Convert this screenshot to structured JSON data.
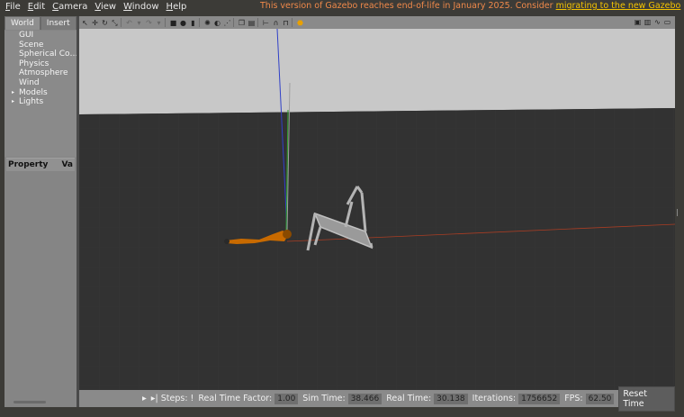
{
  "menu": [
    {
      "label": "File",
      "key": "F",
      "rest": "ile"
    },
    {
      "label": "Edit",
      "key": "E",
      "rest": "dit"
    },
    {
      "label": "Camera",
      "key": "C",
      "rest": "amera"
    },
    {
      "label": "View",
      "key": "V",
      "rest": "iew"
    },
    {
      "label": "Window",
      "key": "W",
      "rest": "indow"
    },
    {
      "label": "Help",
      "key": "H",
      "rest": "elp"
    }
  ],
  "banner": {
    "text": "This version of Gazebo reaches end-of-life in January 2025. Consider ",
    "link": "migrating to the new Gazebo",
    "text_color": "#f0894a",
    "link_color": "#f5c400"
  },
  "left_panel": {
    "tabs": [
      "World",
      "Insert"
    ],
    "tree": [
      {
        "label": "GUI",
        "expandable": false
      },
      {
        "label": "Scene",
        "expandable": false
      },
      {
        "label": "Spherical Co…",
        "expandable": false
      },
      {
        "label": "Physics",
        "expandable": false
      },
      {
        "label": "Atmosphere",
        "expandable": false
      },
      {
        "label": "Wind",
        "expandable": false
      },
      {
        "label": "Models",
        "expandable": true
      },
      {
        "label": "Lights",
        "expandable": true
      }
    ],
    "property_header": {
      "col1": "Property",
      "col2": "Va"
    }
  },
  "toolbar": {
    "icons": [
      "select-arrow-icon",
      "translate-icon",
      "rotate-icon",
      "scale-icon",
      "undo-icon",
      "undo-history-icon",
      "redo-icon",
      "redo-history-icon",
      "box-icon",
      "sphere-icon",
      "cylinder-icon",
      "point-light-icon",
      "spot-light-icon",
      "directional-light-icon",
      "copy-icon",
      "paste-icon",
      "align-icon",
      "snap-icon",
      "change-view-icon",
      "screenshot-icon"
    ],
    "right_icons": [
      "screenshot-icon",
      "log-icon",
      "plot-icon",
      "video-record-icon"
    ]
  },
  "bottom": {
    "steps_label": "Steps:",
    "steps_value": "!",
    "rtf_label": "Real Time Factor:",
    "rtf_value": "1.00",
    "sim_time_label": "Sim Time:",
    "sim_time_value": "38.466",
    "real_time_label": "Real Time:",
    "real_time_value": "30.138",
    "iterations_label": "Iterations:",
    "iterations_value": "1756652",
    "fps_label": "FPS:",
    "fps_value": "62.50",
    "reset_label": "Reset Time"
  },
  "colors": {
    "sky": "#c8c8c8",
    "ground": "#323232",
    "robot_arm": "#c86a00",
    "chair": "#b4b4b4",
    "axis_x": "#c84020",
    "axis_y": "#30a030",
    "axis_z": "#3040c8"
  }
}
